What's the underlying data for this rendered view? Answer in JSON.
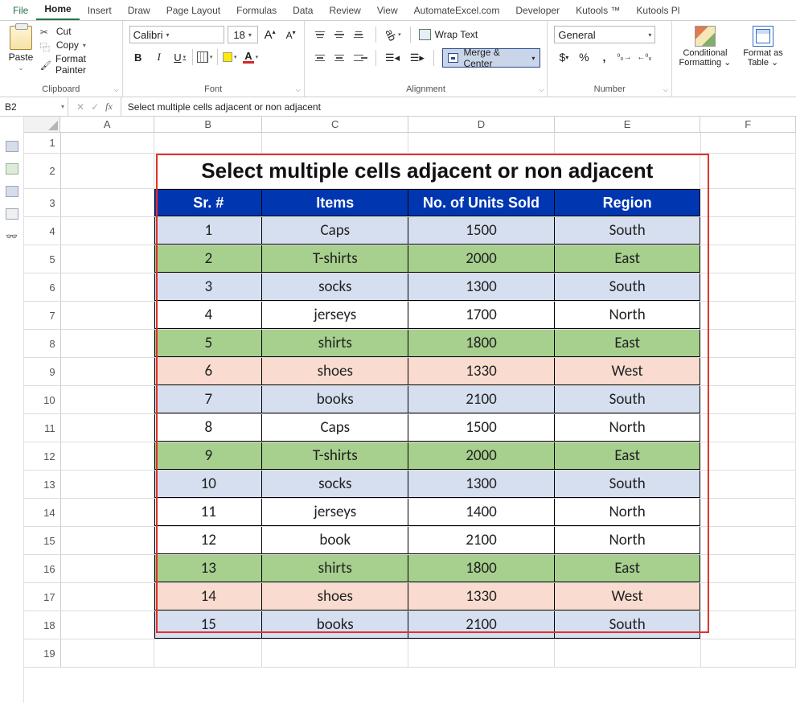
{
  "tabs": {
    "file": "File",
    "home": "Home",
    "insert": "Insert",
    "draw": "Draw",
    "page_layout": "Page Layout",
    "formulas": "Formulas",
    "data": "Data",
    "review": "Review",
    "view": "View",
    "automate": "AutomateExcel.com",
    "developer": "Developer",
    "kutools": "Kutools ™",
    "kutools_plus": "Kutools Pl"
  },
  "ribbon": {
    "clipboard": {
      "label": "Clipboard",
      "paste": "Paste",
      "cut": "Cut",
      "copy": "Copy",
      "format_painter": "Format Painter"
    },
    "font": {
      "label": "Font",
      "name": "Calibri",
      "size": "18",
      "bold": "B",
      "italic": "I",
      "underline": "U",
      "increase": "A",
      "decrease": "A",
      "color_letter": "A"
    },
    "alignment": {
      "label": "Alignment",
      "wrap": "Wrap Text",
      "merge": "Merge & Center"
    },
    "number": {
      "label": "Number",
      "format": "General",
      "currency": "$",
      "percent": "%",
      "comma": ",",
      "inc_dec": ".0",
      "dec_dec": ".00"
    },
    "styles": {
      "cf": "Conditional Formatting",
      "ft": "Format as Table"
    }
  },
  "formula_bar": {
    "namebox": "B2",
    "fx": "fx",
    "content": "Select multiple cells adjacent or non adjacent"
  },
  "columns": [
    "A",
    "B",
    "C",
    "D",
    "E",
    "F"
  ],
  "row_numbers": [
    "1",
    "2",
    "3",
    "4",
    "5",
    "6",
    "7",
    "8",
    "9",
    "10",
    "11",
    "12",
    "13",
    "14",
    "15",
    "16",
    "17",
    "18",
    "19"
  ],
  "sheet": {
    "title": "Select multiple cells adjacent or non adjacent",
    "headers": {
      "sr": "Sr. #",
      "items": "Items",
      "units": "No. of Units Sold",
      "region": "Region"
    },
    "rows": [
      {
        "sr": "1",
        "item": "Caps",
        "units": "1500",
        "region": "South",
        "fill": "blue"
      },
      {
        "sr": "2",
        "item": "T-shirts",
        "units": "2000",
        "region": "East",
        "fill": "green"
      },
      {
        "sr": "3",
        "item": "socks",
        "units": "1300",
        "region": "South",
        "fill": "blue"
      },
      {
        "sr": "4",
        "item": "jerseys",
        "units": "1700",
        "region": "North",
        "fill": "white"
      },
      {
        "sr": "5",
        "item": "shirts",
        "units": "1800",
        "region": "East",
        "fill": "green"
      },
      {
        "sr": "6",
        "item": "shoes",
        "units": "1330",
        "region": "West",
        "fill": "peach"
      },
      {
        "sr": "7",
        "item": "books",
        "units": "2100",
        "region": "South",
        "fill": "blue"
      },
      {
        "sr": "8",
        "item": "Caps",
        "units": "1500",
        "region": "North",
        "fill": "white"
      },
      {
        "sr": "9",
        "item": "T-shirts",
        "units": "2000",
        "region": "East",
        "fill": "green"
      },
      {
        "sr": "10",
        "item": "socks",
        "units": "1300",
        "region": "South",
        "fill": "blue"
      },
      {
        "sr": "11",
        "item": "jerseys",
        "units": "1400",
        "region": "North",
        "fill": "white"
      },
      {
        "sr": "12",
        "item": "book",
        "units": "2100",
        "region": "North",
        "fill": "white"
      },
      {
        "sr": "13",
        "item": "shirts",
        "units": "1800",
        "region": "East",
        "fill": "green"
      },
      {
        "sr": "14",
        "item": "shoes",
        "units": "1330",
        "region": "West",
        "fill": "peach"
      },
      {
        "sr": "15",
        "item": "books",
        "units": "2100",
        "region": "South",
        "fill": "blue"
      }
    ]
  }
}
